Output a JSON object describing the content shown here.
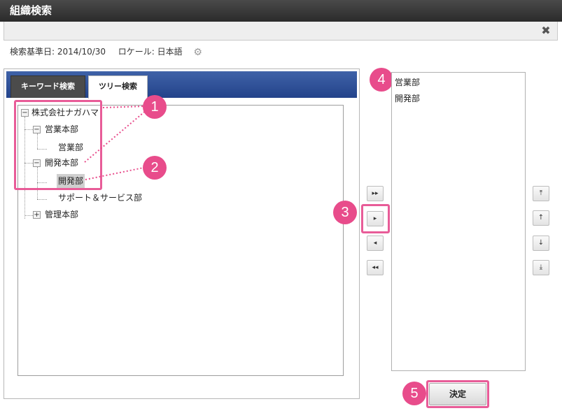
{
  "window": {
    "title": "組織検索"
  },
  "toolbar": {
    "close_glyph": "✖"
  },
  "info": {
    "base_date_label": "検索基準日:",
    "base_date": "2014/10/30",
    "locale_label": "ロケール:",
    "locale": "日本語"
  },
  "tabs": [
    {
      "label": "キーワード検索",
      "active": false
    },
    {
      "label": "ツリー検索",
      "active": true
    }
  ],
  "tree": {
    "root": "株式会社ナガハマ",
    "sales_hq": "営業本部",
    "sales_dept": "営業部",
    "dev_hq": "開発本部",
    "dev_dept": "開発部",
    "support_dept": "サポート＆サービス部",
    "admin_hq": "管理本部"
  },
  "toggles": {
    "minus": "−",
    "plus": "+"
  },
  "move_buttons": {
    "add_all": "▸▸",
    "add": "▸",
    "remove": "◂",
    "remove_all": "◂◂"
  },
  "order_buttons": {
    "top": "⤒",
    "up": "↑",
    "down": "↓",
    "bottom": "⤓"
  },
  "selected_list": [
    "営業部",
    "開発部"
  ],
  "callouts": [
    "1",
    "2",
    "3",
    "4",
    "5"
  ],
  "confirm_label": "決定",
  "colors": {
    "accent": "#e84c8b",
    "tabbar": "#23438a",
    "titlebar": "#2b2b2b"
  }
}
